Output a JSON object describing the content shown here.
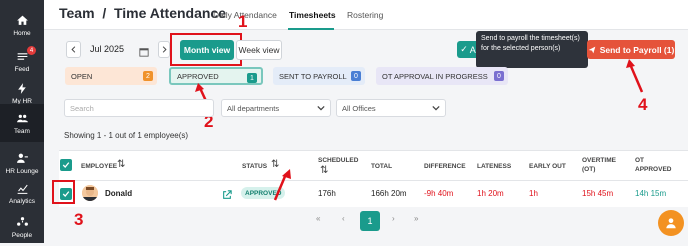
{
  "sidebar": {
    "items": [
      {
        "label": "Home",
        "icon": "home-icon"
      },
      {
        "label": "Feed",
        "icon": "feed-icon",
        "badge": "4"
      },
      {
        "label": "My HR",
        "icon": "bolt-icon"
      },
      {
        "label": "Team",
        "icon": "team-icon"
      },
      {
        "label": "HR Lounge",
        "icon": "lounge-icon"
      },
      {
        "label": "Analytics",
        "icon": "analytics-icon"
      },
      {
        "label": "People",
        "icon": "people-icon"
      }
    ]
  },
  "header": {
    "title": "Team  /  Time Attendance",
    "tabs": [
      "Daily Attendance",
      "Timesheets",
      "Rostering"
    ],
    "active_tab": "Timesheets"
  },
  "toolbar": {
    "period": "Jul 2025",
    "month_view": "Month view",
    "week_view": "Week view",
    "approve_label": "A",
    "tooltip": "Send to payroll the timesheet(s) for the selected person(s)",
    "send_to_payroll": "Send to Payroll (1)"
  },
  "status_cards": [
    {
      "label": "OPEN",
      "count": "2",
      "bg": "#fde6d6",
      "count_color": "#f0922b"
    },
    {
      "label": "APPROVED",
      "count": "1",
      "bg": "#e4f4ef",
      "count_color": "#1a9b8c"
    },
    {
      "label": "SENT TO PAYROLL",
      "count": "0",
      "bg": "#e4ecf8",
      "count_color": "#4a7fd4"
    },
    {
      "label": "OT APPROVAL IN PROGRESS",
      "count": "0",
      "bg": "#e8e6f6",
      "count_color": "#7a6fd0"
    }
  ],
  "filters": {
    "search_placeholder": "Search",
    "departments": "All departments",
    "offices": "All Offices"
  },
  "showing": "Showing 1 - 1 out of 1 employee(s)",
  "table": {
    "headers": [
      "EMPLOYEE",
      "STATUS",
      "SCHEDULED",
      "TOTAL",
      "DIFFERENCE",
      "LATENESS",
      "EARLY OUT",
      "OVERTIME (OT)",
      "OT APPROVED"
    ],
    "row": {
      "name": "Donald",
      "status": "APPROVED",
      "scheduled": "176h",
      "total": "166h 20m",
      "difference": "-9h 40m",
      "lateness": "1h 20m",
      "early_out": "1h",
      "overtime": "15h 45m",
      "ot_approved": "14h 15m"
    }
  },
  "pagination": {
    "first": "«",
    "prev": "‹",
    "page": "1",
    "next": "›",
    "last": "»"
  },
  "annotations": [
    "1",
    "2",
    "3",
    "4"
  ],
  "colors": {
    "accent": "#1a9b8c",
    "danger": "#e0121b",
    "payroll": "#e5533a"
  }
}
